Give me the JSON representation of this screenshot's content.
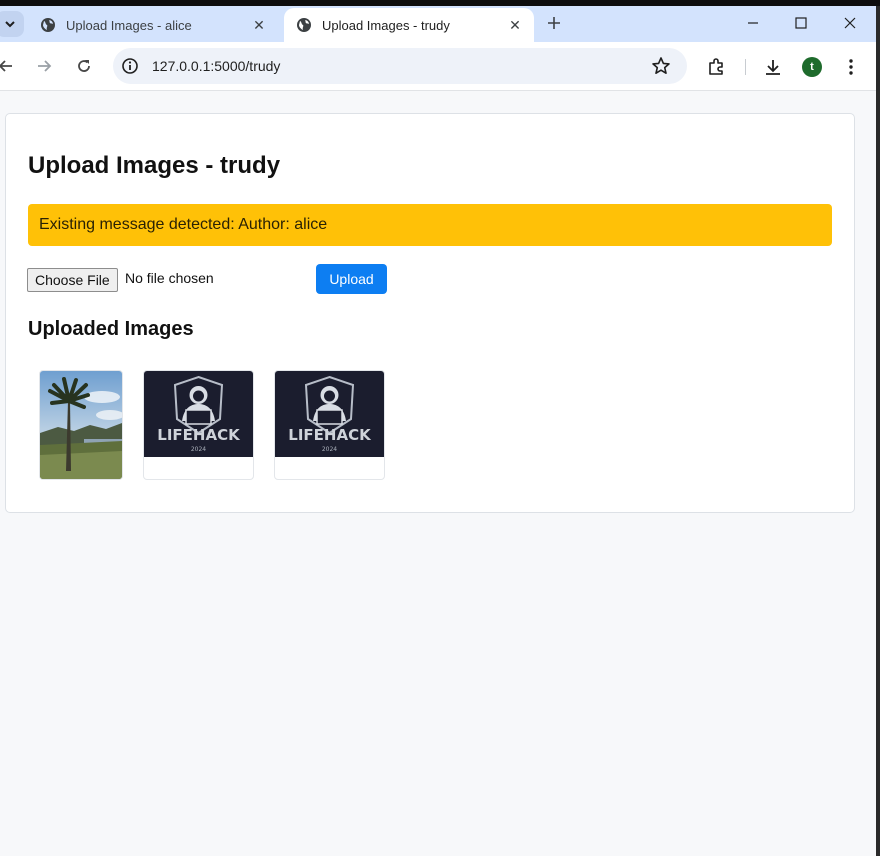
{
  "browser": {
    "tabs": [
      {
        "title": "Upload Images - alice",
        "active": false
      },
      {
        "title": "Upload Images - trudy",
        "active": true
      }
    ],
    "address_bar": {
      "url": "127.0.0.1:5000/trudy"
    },
    "profile_initial": "t",
    "colors": {
      "tab_strip": "#d3e3fd",
      "profile": "#1e6b2c"
    }
  },
  "page": {
    "title": "Upload Images - trudy",
    "alert": {
      "text": "Existing message detected: Author: alice",
      "color": "#ffc107"
    },
    "file_input": {
      "button_label": "Choose File",
      "status": "No file chosen"
    },
    "upload_button": {
      "label": "Upload",
      "color": "#0d7ef2"
    },
    "uploaded_section": {
      "title": "Uploaded Images"
    },
    "images": [
      {
        "kind": "photo",
        "subject": "palm tree landscape"
      },
      {
        "kind": "logo",
        "logo_text": "LIFEHACK",
        "logo_subtext": "2024"
      },
      {
        "kind": "logo",
        "logo_text": "LIFEHACK",
        "logo_subtext": "2024"
      }
    ]
  }
}
